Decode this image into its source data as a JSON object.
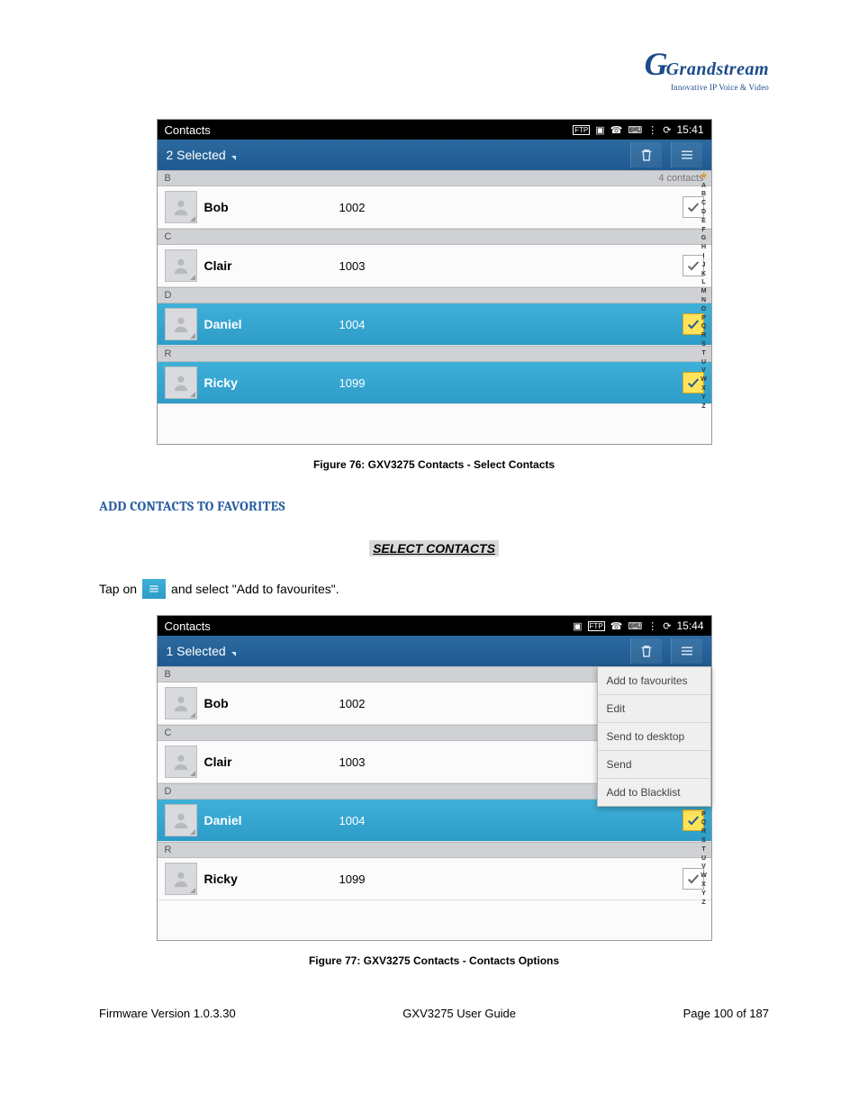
{
  "logo": {
    "brand": "Grandstream",
    "tagline": "Innovative IP Voice & Video"
  },
  "fig76": {
    "caption": "Figure 76: GXV3275 Contacts - Select Contacts",
    "statusbar": {
      "title": "Contacts",
      "time": "15:41"
    },
    "header": {
      "selected": "2 Selected",
      "totals": "4 contacts"
    },
    "sections": [
      {
        "letter": "B",
        "showTotals": true,
        "rows": [
          {
            "name": "Bob",
            "number": "1002",
            "checked": false
          }
        ]
      },
      {
        "letter": "C",
        "rows": [
          {
            "name": "Clair",
            "number": "1003",
            "checked": false
          }
        ]
      },
      {
        "letter": "D",
        "rows": [
          {
            "name": "Daniel",
            "number": "1004",
            "checked": true
          }
        ]
      },
      {
        "letter": "R",
        "rows": [
          {
            "name": "Ricky",
            "number": "1099",
            "checked": true
          }
        ]
      }
    ]
  },
  "heading": "ADD CONTACTS TO FAVORITES",
  "subheading": "SELECT CONTACTS",
  "instruction_pre": "Tap on",
  "instruction_post": "and select \"Add to favourites\".",
  "fig77": {
    "caption": "Figure 77: GXV3275 Contacts - Contacts Options",
    "statusbar": {
      "title": "Contacts",
      "time": "15:44"
    },
    "header": {
      "selected": "1 Selected"
    },
    "menu": [
      "Add to favourites",
      "Edit",
      "Send to desktop",
      "Send",
      "Add to Blacklist"
    ],
    "sections": [
      {
        "letter": "B",
        "rows": [
          {
            "name": "Bob",
            "number": "1002",
            "checked": false
          }
        ]
      },
      {
        "letter": "C",
        "rows": [
          {
            "name": "Clair",
            "number": "1003",
            "checked": false
          }
        ]
      },
      {
        "letter": "D",
        "rows": [
          {
            "name": "Daniel",
            "number": "1004",
            "checked": true
          }
        ]
      },
      {
        "letter": "R",
        "rows": [
          {
            "name": "Ricky",
            "number": "1099",
            "checked": false
          }
        ]
      }
    ]
  },
  "azindex": [
    "A",
    "B",
    "C",
    "D",
    "E",
    "F",
    "G",
    "H",
    "I",
    "J",
    "K",
    "L",
    "M",
    "N",
    "O",
    "P",
    "Q",
    "R",
    "S",
    "T",
    "U",
    "V",
    "W",
    "X",
    "Y",
    "Z"
  ],
  "footer": {
    "left": "Firmware Version 1.0.3.30",
    "center": "GXV3275 User Guide",
    "right": "Page 100 of 187"
  }
}
